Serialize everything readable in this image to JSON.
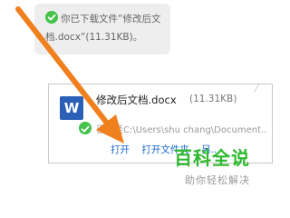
{
  "message": {
    "line1": "你已下载文件“修改后文",
    "line2": "档.docx”(11.31KB)。",
    "check_icon": "check-circle-icon"
  },
  "file_card": {
    "name": "修改后文档.docx",
    "size": "(11.31KB)",
    "path": "已存至C:\\Users\\shu chang\\Document...",
    "icon": "word-document-icon",
    "actions": {
      "open": "打开",
      "open_folder": "打开文件夹",
      "more": "另..."
    }
  },
  "watermark": {
    "main": "百科全说",
    "sub": "助你轻松解决"
  },
  "colors": {
    "arrow": "#f07f1d",
    "accent": "#44c24a",
    "link": "#1a68c9",
    "watermark": "#2eb82e"
  }
}
